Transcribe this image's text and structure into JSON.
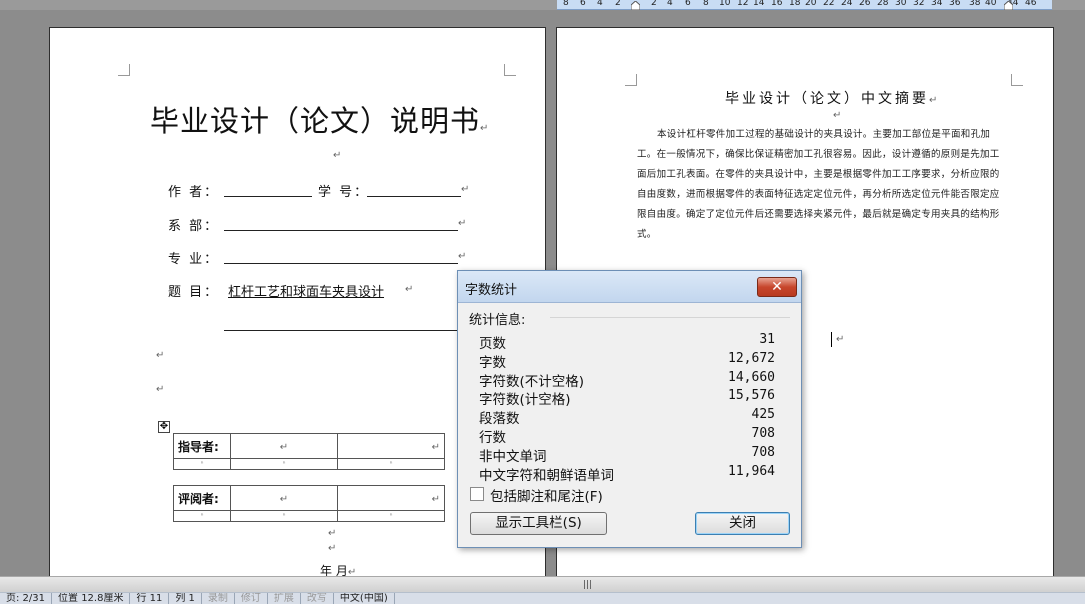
{
  "ruler": {
    "ticks": [
      "8",
      "6",
      "4",
      "2",
      "2",
      "4",
      "6",
      "8",
      "10",
      "12",
      "14",
      "16",
      "18",
      "20",
      "22",
      "24",
      "26",
      "28",
      "30",
      "32",
      "34",
      "36",
      "38",
      "40",
      "44",
      "46"
    ]
  },
  "page_left": {
    "title": "毕业设计（论文）说明书",
    "fields": {
      "author_label": "作    者：",
      "student_id_label": "学  号：",
      "department_label": "系    部：",
      "major_label": "专    业：",
      "topic_label": "题    目：",
      "topic_value": "  杠杆工艺和球面车夹具设计  "
    },
    "tables": {
      "advisor_label": "指导者:",
      "reviewer_label": "评阅者:"
    },
    "date_line": "年    月"
  },
  "page_right": {
    "abstract_title": "毕业设计（论文）中文摘要",
    "abstract_body": "本设计杠杆零件加工过程的基础设计的夹具设计。主要加工部位是平面和孔加工。在一般情况下，确保比保证精密加工孔很容易。因此，设计遵循的原则是先加工面后加工孔表面。在零件的夹具设计中，主要是根据零件加工工序要求，分析应限的自由度数，进而根据零件的表面特征选定定位元件，再分析所选定位元件能否限定应限自由度。确定了定位元件后还需要选择夹紧元件，最后就是确定专用夹具的结构形式。"
  },
  "dialog": {
    "title": "字数统计",
    "close_glyph": "✕",
    "section_label": "统计信息:",
    "stats": [
      {
        "label": "页数",
        "value": "31"
      },
      {
        "label": "字数",
        "value": "12,672"
      },
      {
        "label": "字符数(不计空格)",
        "value": "14,660"
      },
      {
        "label": "字符数(计空格)",
        "value": "15,576"
      },
      {
        "label": "段落数",
        "value": "425"
      },
      {
        "label": "行数",
        "value": "708"
      },
      {
        "label": "非中文单词",
        "value": "708"
      },
      {
        "label": "中文字符和朝鲜语单词",
        "value": "11,964"
      }
    ],
    "checkbox_label": "包括脚注和尾注(F)",
    "checkbox_checked": false,
    "toolbar_button": "显示工具栏(S)",
    "close_button": "关闭"
  },
  "statusbar": {
    "page": "页: 2/31",
    "position": "位置 12.8厘米",
    "line": "行 11",
    "column": "列 1",
    "modes": [
      "录制",
      "修订",
      "扩展",
      "改写"
    ],
    "language": "中文(中国)"
  },
  "colors": {
    "dialog_close": "#c7462c",
    "ruler": "#c8dcf4",
    "workspace": "#8c8c8c"
  }
}
